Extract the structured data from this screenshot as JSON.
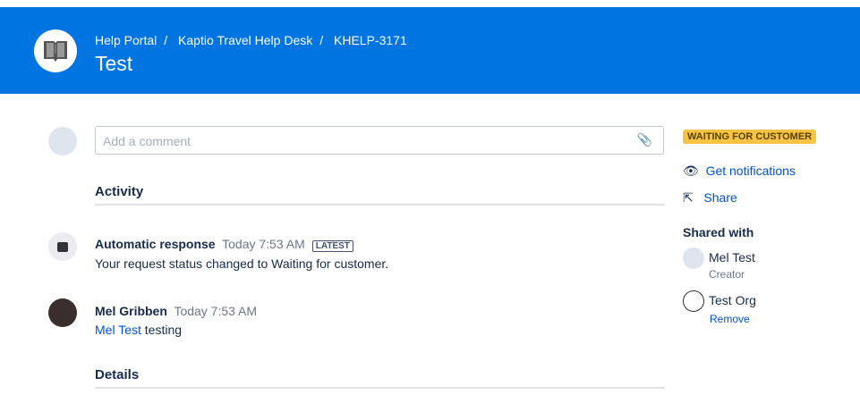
{
  "header": {
    "breadcrumbs": [
      "Help Portal",
      "Kaptio Travel Help Desk",
      "KHELP-3171"
    ],
    "separator": "/",
    "title": "Test"
  },
  "comment": {
    "placeholder": "Add a comment"
  },
  "activity": {
    "heading": "Activity",
    "items": [
      {
        "author": "Automatic response",
        "time": "Today 7:53 AM",
        "badge": "LATEST",
        "body": "Your request status changed to Waiting for customer."
      },
      {
        "author": "Mel Gribben",
        "time": "Today 7:53 AM",
        "mention": "Mel Test",
        "body": " testing"
      }
    ]
  },
  "details": {
    "heading": "Details"
  },
  "sidebar": {
    "status": "WAITING FOR CUSTOMER",
    "status_color": "#f6c342",
    "notifications": "Get notifications",
    "share": "Share",
    "shared_heading": "Shared with",
    "people": [
      {
        "name": "Mel Test",
        "role": "Creator"
      },
      {
        "name": "Test Org",
        "action": "Remove"
      }
    ]
  }
}
